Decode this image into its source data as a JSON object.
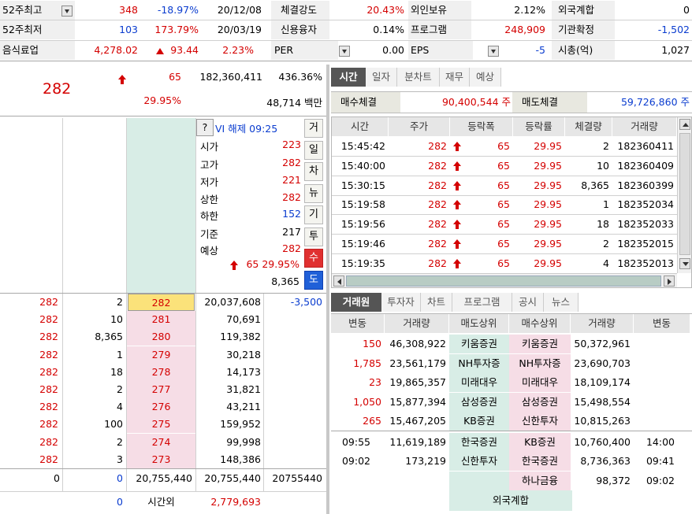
{
  "summary": {
    "row1": [
      {
        "label": "52주최고",
        "v1": "348",
        "v2": "-18.97%",
        "v3": "20/12/08"
      },
      {
        "label": "체결강도",
        "v": "20.43%"
      },
      {
        "label": "외인보유",
        "v": "2.12%"
      },
      {
        "label": "외국계합",
        "v": "0"
      }
    ],
    "row2": [
      {
        "label": "52주최저",
        "v1": "103",
        "v2": "173.79%",
        "v3": "20/03/19"
      },
      {
        "label": "신용융자",
        "v": "0.14%"
      },
      {
        "label": "프로그램",
        "v": "248,909"
      },
      {
        "label": "기관확정",
        "v": "-1,502"
      }
    ],
    "row3": [
      {
        "label": "음식료업",
        "v1": "4,278.02",
        "v2": "93.44",
        "v3": "2.23%"
      },
      {
        "label": "PER",
        "v": "0.00"
      },
      {
        "label": "EPS",
        "v": "-5"
      },
      {
        "label": "시총(억)",
        "v": "1,027"
      }
    ]
  },
  "price": {
    "current": "282",
    "change": "65",
    "volume": "182,360,411",
    "vol_ratio": "436.36%",
    "change_rate": "29.95%",
    "amount": "48,714 백만"
  },
  "info": {
    "q": "?",
    "vi": "VI 해제 09:25",
    "items": [
      {
        "k": "시가",
        "v": "223"
      },
      {
        "k": "고가",
        "v": "282"
      },
      {
        "k": "저가",
        "v": "221"
      },
      {
        "k": "상한",
        "v": "282"
      },
      {
        "k": "하한",
        "v": "152"
      },
      {
        "k": "기준",
        "v": "217"
      },
      {
        "k": "예상",
        "v": "282"
      }
    ],
    "exp_chg": "65",
    "exp_rate": "29.95%",
    "exp_vol": "8,365"
  },
  "side_buttons": [
    "거",
    "일",
    "차",
    "뉴",
    "기",
    "투",
    "수",
    "도"
  ],
  "orderbook": {
    "bids": [
      {
        "a": "282",
        "b": "2",
        "p": "282",
        "q": "20,037,608",
        "d": "-3,500"
      },
      {
        "a": "282",
        "b": "10",
        "p": "281",
        "q": "70,691"
      },
      {
        "a": "282",
        "b": "8,365",
        "p": "280",
        "q": "119,382"
      },
      {
        "a": "282",
        "b": "1",
        "p": "279",
        "q": "30,218"
      },
      {
        "a": "282",
        "b": "18",
        "p": "278",
        "q": "14,173"
      },
      {
        "a": "282",
        "b": "2",
        "p": "277",
        "q": "31,821"
      },
      {
        "a": "282",
        "b": "4",
        "p": "276",
        "q": "43,211"
      },
      {
        "a": "282",
        "b": "100",
        "p": "275",
        "q": "159,952"
      },
      {
        "a": "282",
        "b": "2",
        "p": "274",
        "q": "99,998"
      },
      {
        "a": "282",
        "b": "3",
        "p": "273",
        "q": "148,386"
      }
    ],
    "total": {
      "a": "0",
      "b": "0",
      "c": "20,755,440",
      "d": "20,755,440",
      "e": "20755440"
    },
    "after": {
      "b": "0",
      "label": "시간외",
      "q": "2,779,693"
    }
  },
  "time_tabs": [
    "시간",
    "일자",
    "분차트",
    "재무",
    "예상"
  ],
  "fill": {
    "buy_label": "매수체결",
    "buy": "90,400,544 주",
    "sell_label": "매도체결",
    "sell": "59,726,860 주"
  },
  "ticks": {
    "headers": [
      "시간",
      "주가",
      "등락폭",
      "등락률",
      "체결량",
      "거래량"
    ],
    "rows": [
      [
        "15:45:42",
        "282",
        "65",
        "29.95",
        "2",
        "182360411"
      ],
      [
        "15:40:00",
        "282",
        "65",
        "29.95",
        "10",
        "182360409"
      ],
      [
        "15:30:15",
        "282",
        "65",
        "29.95",
        "8,365",
        "182360399"
      ],
      [
        "15:19:58",
        "282",
        "65",
        "29.95",
        "1",
        "182352034"
      ],
      [
        "15:19:56",
        "282",
        "65",
        "29.95",
        "18",
        "182352033"
      ],
      [
        "15:19:46",
        "282",
        "65",
        "29.95",
        "2",
        "182352015"
      ],
      [
        "15:19:35",
        "282",
        "65",
        "29.95",
        "4",
        "182352013"
      ]
    ]
  },
  "broker_tabs": [
    "거래원",
    "투자자",
    "차트",
    "프로그램",
    "공시",
    "뉴스"
  ],
  "brokers": {
    "headers": [
      "변동",
      "거래량",
      "매도상위",
      "매수상위",
      "거래량",
      "변동"
    ],
    "rows": [
      [
        "150",
        "46,308,922",
        "키움증권",
        "키움증권",
        "50,372,961",
        ""
      ],
      [
        "1,785",
        "23,561,179",
        "NH투자증",
        "NH투자증",
        "23,690,703",
        ""
      ],
      [
        "23",
        "19,865,357",
        "미래대우",
        "미래대우",
        "18,109,174",
        ""
      ],
      [
        "1,050",
        "15,877,394",
        "삼성증권",
        "삼성증권",
        "15,498,554",
        ""
      ],
      [
        "265",
        "15,467,205",
        "KB증권",
        "신한투자",
        "10,815,263",
        ""
      ],
      [
        "09:55",
        "11,619,189",
        "한국증권",
        "KB증권",
        "10,760,400",
        "14:00"
      ],
      [
        "09:02",
        "173,219",
        "신한투자",
        "한국증권",
        "8,736,363",
        "09:41"
      ],
      [
        "",
        "",
        "",
        "하나금융",
        "98,372",
        "09:02"
      ]
    ],
    "foreign_label": "외국계합"
  },
  "colors": {
    "up": "#d40000",
    "down": "#0a3ccf",
    "highlight": "#fbe27a",
    "bid_bg": "#f6dde6",
    "center_bg": "#d8ede6",
    "broker_bg": "#d8ede6"
  }
}
